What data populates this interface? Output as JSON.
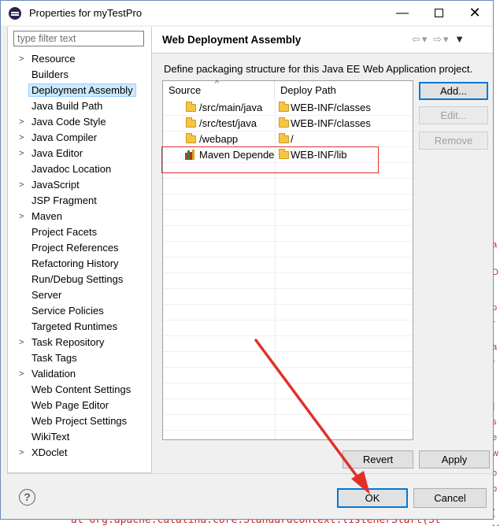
{
  "window": {
    "title": "Properties for myTestPro"
  },
  "filter": {
    "placeholder": "type filter text"
  },
  "tree": [
    {
      "label": "Resource",
      "expandable": true
    },
    {
      "label": "Builders",
      "expandable": false
    },
    {
      "label": "Deployment Assembly",
      "expandable": false,
      "selected": true
    },
    {
      "label": "Java Build Path",
      "expandable": false
    },
    {
      "label": "Java Code Style",
      "expandable": true
    },
    {
      "label": "Java Compiler",
      "expandable": true
    },
    {
      "label": "Java Editor",
      "expandable": true
    },
    {
      "label": "Javadoc Location",
      "expandable": false
    },
    {
      "label": "JavaScript",
      "expandable": true
    },
    {
      "label": "JSP Fragment",
      "expandable": false
    },
    {
      "label": "Maven",
      "expandable": true
    },
    {
      "label": "Project Facets",
      "expandable": false
    },
    {
      "label": "Project References",
      "expandable": false
    },
    {
      "label": "Refactoring History",
      "expandable": false
    },
    {
      "label": "Run/Debug Settings",
      "expandable": false
    },
    {
      "label": "Server",
      "expandable": false
    },
    {
      "label": "Service Policies",
      "expandable": false
    },
    {
      "label": "Targeted Runtimes",
      "expandable": false
    },
    {
      "label": "Task Repository",
      "expandable": true
    },
    {
      "label": "Task Tags",
      "expandable": false
    },
    {
      "label": "Validation",
      "expandable": true
    },
    {
      "label": "Web Content Settings",
      "expandable": false
    },
    {
      "label": "Web Page Editor",
      "expandable": false
    },
    {
      "label": "Web Project Settings",
      "expandable": false
    },
    {
      "label": "WikiText",
      "expandable": false
    },
    {
      "label": "XDoclet",
      "expandable": true
    }
  ],
  "page": {
    "title": "Web Deployment Assembly",
    "description": "Define packaging structure for this Java EE Web Application project.",
    "columns": {
      "source": "Source",
      "deploy": "Deploy Path"
    },
    "rows": [
      {
        "source": "/src/main/java",
        "deploy": "WEB-INF/classes",
        "icon": "folder-icon"
      },
      {
        "source": "/src/test/java",
        "deploy": "WEB-INF/classes",
        "icon": "folder-icon"
      },
      {
        "source": "/webapp",
        "deploy": "/",
        "icon": "folder-icon"
      },
      {
        "source": "Maven Depende",
        "deploy": "WEB-INF/lib",
        "icon": "library-icon"
      }
    ],
    "buttons": {
      "add": "Add...",
      "edit": "Edit...",
      "remove": "Remove"
    },
    "revert": "Revert",
    "apply": "Apply"
  },
  "footer": {
    "ok": "OK",
    "cancel": "Cancel",
    "help_glyph": "?"
  },
  "background_text": "at org.apache.catalina.core.StandardContext.listenerStart(St",
  "colors": {
    "accent": "#0078d7",
    "selection": "#cce8ff",
    "annotation": "#e0302a"
  }
}
